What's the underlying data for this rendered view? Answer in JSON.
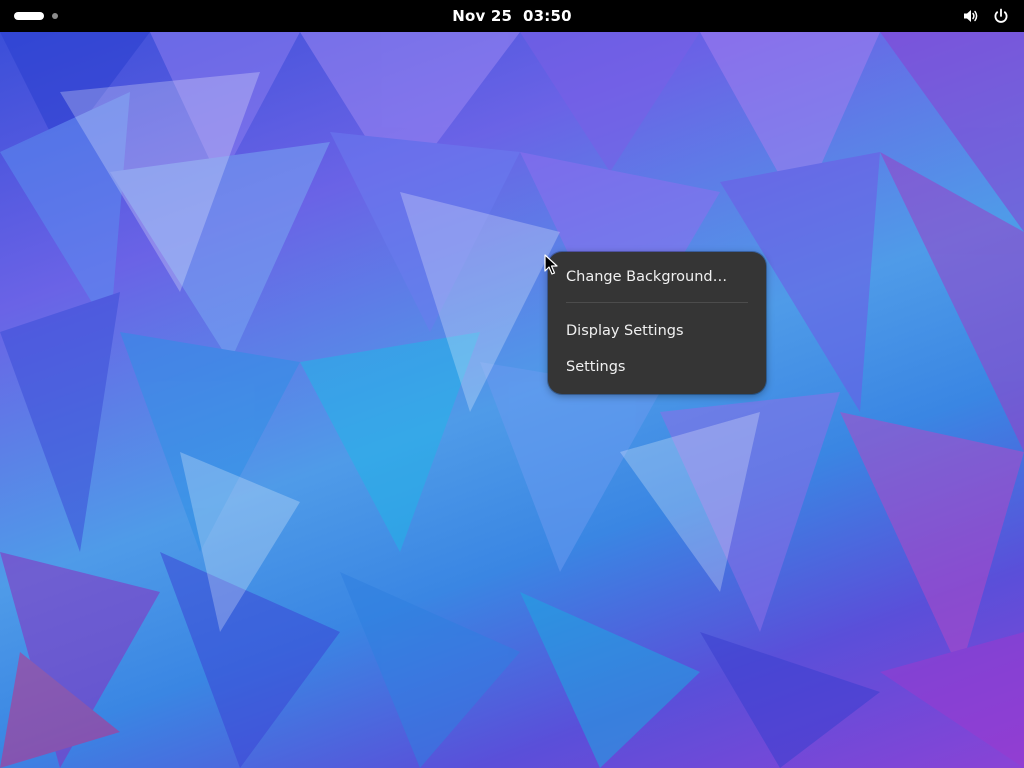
{
  "topbar": {
    "clock_date": "Nov 25",
    "clock_time": "03:50",
    "volume_icon": "speaker-volume-icon",
    "power_icon": "power-icon"
  },
  "context_menu": {
    "items": [
      {
        "label": "Change Background…"
      },
      {
        "label": "Display Settings"
      },
      {
        "label": "Settings"
      }
    ]
  },
  "colors": {
    "topbar_bg": "#000000",
    "menu_bg": "#353535",
    "menu_text": "#f0f0f0"
  }
}
